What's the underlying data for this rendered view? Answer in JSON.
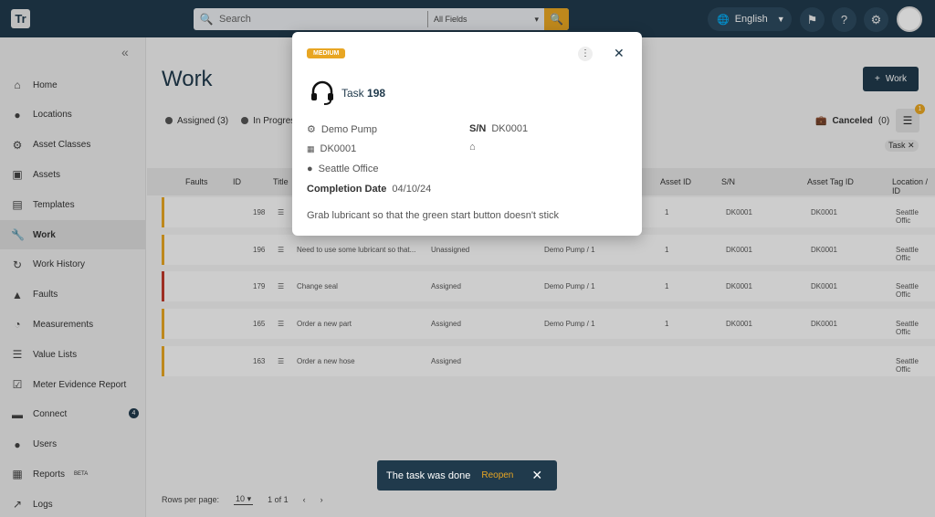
{
  "header": {
    "logo": "Tr",
    "search_placeholder": "Search",
    "search_scope": "All Fields",
    "language": "English"
  },
  "sidebar": {
    "items": [
      {
        "label": "Home",
        "icon": "home-icon"
      },
      {
        "label": "Locations",
        "icon": "location-icon"
      },
      {
        "label": "Asset Classes",
        "icon": "asset-classes-icon"
      },
      {
        "label": "Assets",
        "icon": "assets-icon"
      },
      {
        "label": "Templates",
        "icon": "templates-icon"
      },
      {
        "label": "Work",
        "icon": "wrench-icon"
      },
      {
        "label": "Work History",
        "icon": "work-history-icon"
      },
      {
        "label": "Faults",
        "icon": "warning-icon"
      },
      {
        "label": "Measurements",
        "icon": "gauge-icon"
      },
      {
        "label": "Value Lists",
        "icon": "list-icon"
      },
      {
        "label": "Meter Evidence Report",
        "icon": "checkbox-icon"
      },
      {
        "label": "Connect",
        "icon": "connect-icon",
        "badge": "4"
      },
      {
        "label": "Users",
        "icon": "user-icon"
      },
      {
        "label": "Reports",
        "icon": "reports-icon",
        "superscript": "BETA"
      },
      {
        "label": "Logs",
        "icon": "chart-icon"
      }
    ]
  },
  "main": {
    "title": "Work",
    "add_button": "Work",
    "chips": [
      "Assigned (3)",
      "In Progres"
    ],
    "canceled_label": "Canceled",
    "canceled_count": "(0)",
    "filter_count": "1",
    "filter_tag": "Task",
    "columns": [
      "Faults",
      "ID",
      "Title",
      "Asset ID",
      "S/N",
      "Asset Tag ID",
      "Location / ID"
    ],
    "rows": [
      {
        "id": "198",
        "title": "",
        "status": "",
        "asset": "",
        "asset_id": "1",
        "sn": "DK0001",
        "tag": "DK0001",
        "location": "Seattle Offic"
      },
      {
        "id": "196",
        "title": "Need to use some lubricant so that...",
        "status": "Unassigned",
        "asset": "Demo Pump / 1",
        "asset_id": "1",
        "sn": "DK0001",
        "tag": "DK0001",
        "location": "Seattle Offic"
      },
      {
        "id": "179",
        "title": "Change seal",
        "status": "Assigned",
        "asset": "Demo Pump / 1",
        "asset_id": "1",
        "sn": "DK0001",
        "tag": "DK0001",
        "location": "Seattle Offic"
      },
      {
        "id": "165",
        "title": "Order a new part",
        "status": "Assigned",
        "asset": "Demo Pump / 1",
        "asset_id": "1",
        "sn": "DK0001",
        "tag": "DK0001",
        "location": "Seattle Offic"
      },
      {
        "id": "163",
        "title": "Order a new hose",
        "status": "Assigned",
        "asset": "",
        "asset_id": "",
        "sn": "",
        "tag": "",
        "location": "Seattle Offic"
      }
    ],
    "footer": {
      "rows_label": "Rows per page:",
      "rows_value": "10",
      "range": "1 of 1"
    }
  },
  "modal": {
    "priority": "MEDIUM",
    "task_label": "Task",
    "task_id": "198",
    "asset": "Demo Pump",
    "sn_label": "S/N",
    "sn_value": "DK0001",
    "tag": "DK0001",
    "location": "Seattle Office",
    "completion_label": "Completion Date",
    "completion_date": "04/10/24",
    "description": "Grab lubricant so that the green start button doesn't stick"
  },
  "toast": {
    "message": "The task was done",
    "action": "Reopen"
  },
  "colors": {
    "navy": "#203a4c",
    "accent": "#e8a623",
    "fault_red": "#c0392b"
  }
}
